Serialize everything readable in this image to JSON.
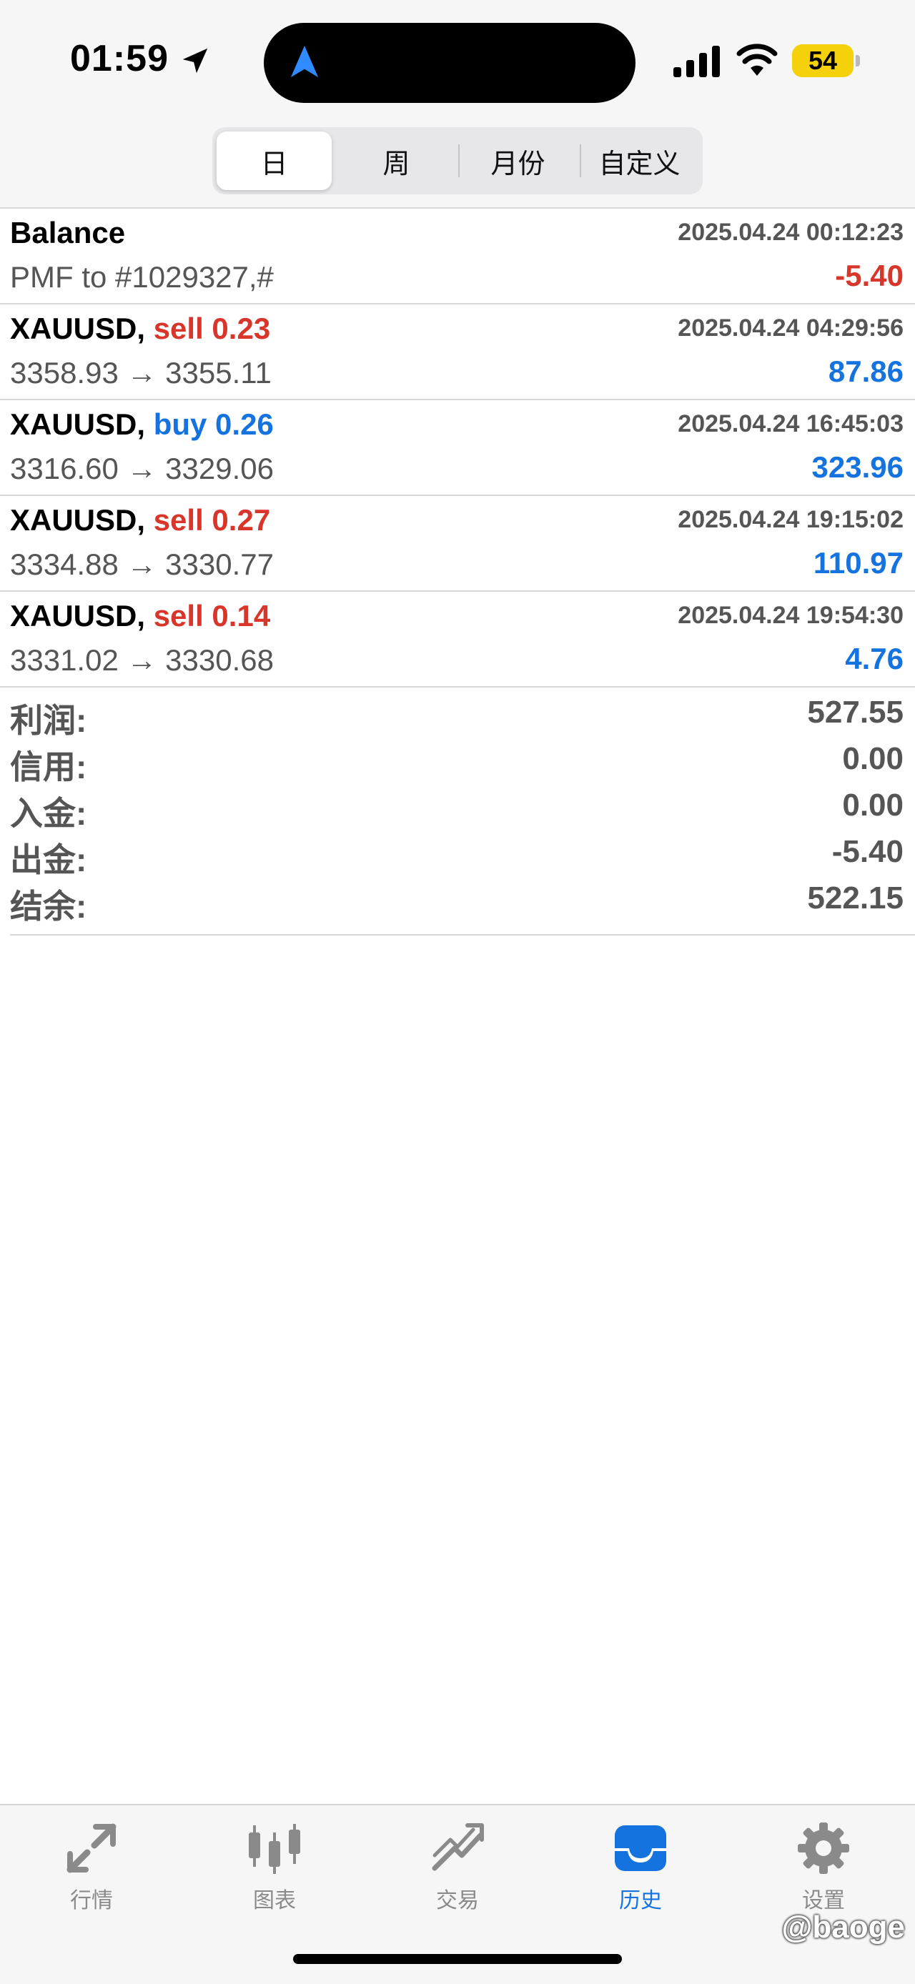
{
  "status_bar": {
    "time": "01:59",
    "battery": "54"
  },
  "segments": [
    {
      "label": "日",
      "active": true
    },
    {
      "label": "周",
      "active": false
    },
    {
      "label": "月份",
      "active": false
    },
    {
      "label": "自定义",
      "active": false
    }
  ],
  "rows": [
    {
      "symbol": "Balance",
      "side": "",
      "time": "2025.04.24 00:12:23",
      "detail": "PMF to #1029327,#",
      "amount": "-5.40",
      "amount_sign": "neg"
    },
    {
      "symbol": "XAUUSD,",
      "side": "sell 0.23",
      "time": "2025.04.24 04:29:56",
      "detail": "3358.93 → 3355.11",
      "amount": "87.86",
      "amount_sign": "pos"
    },
    {
      "symbol": "XAUUSD,",
      "side": "buy 0.26",
      "time": "2025.04.24 16:45:03",
      "detail": "3316.60 → 3329.06",
      "amount": "323.96",
      "amount_sign": "pos"
    },
    {
      "symbol": "XAUUSD,",
      "side": "sell 0.27",
      "time": "2025.04.24 19:15:02",
      "detail": "3334.88 → 3330.77",
      "amount": "110.97",
      "amount_sign": "pos"
    },
    {
      "symbol": "XAUUSD,",
      "side": "sell 0.14",
      "time": "2025.04.24 19:54:30",
      "detail": "3331.02 → 3330.68",
      "amount": "4.76",
      "amount_sign": "pos"
    }
  ],
  "summary": [
    {
      "label": "利润:",
      "value": "527.55"
    },
    {
      "label": "信用:",
      "value": "0.00"
    },
    {
      "label": "入金:",
      "value": "0.00"
    },
    {
      "label": "出金:",
      "value": "-5.40"
    },
    {
      "label": "结余:",
      "value": "522.15"
    }
  ],
  "tabs": [
    {
      "label": "行情",
      "icon": "quotes-icon",
      "active": false
    },
    {
      "label": "图表",
      "icon": "chart-candles-icon",
      "active": false
    },
    {
      "label": "交易",
      "icon": "trade-icon",
      "active": false
    },
    {
      "label": "历史",
      "icon": "history-inbox-icon",
      "active": true
    },
    {
      "label": "设置",
      "icon": "gear-icon",
      "active": false
    }
  ],
  "watermark": "@baoge",
  "colors": {
    "sell": "#d9362b",
    "buy": "#1573e0",
    "negative": "#d9362b",
    "positive": "#1573e0",
    "active_tab": "#1573e0",
    "inactive_tab": "#8a8a8a",
    "battery": "#f5d10b"
  }
}
